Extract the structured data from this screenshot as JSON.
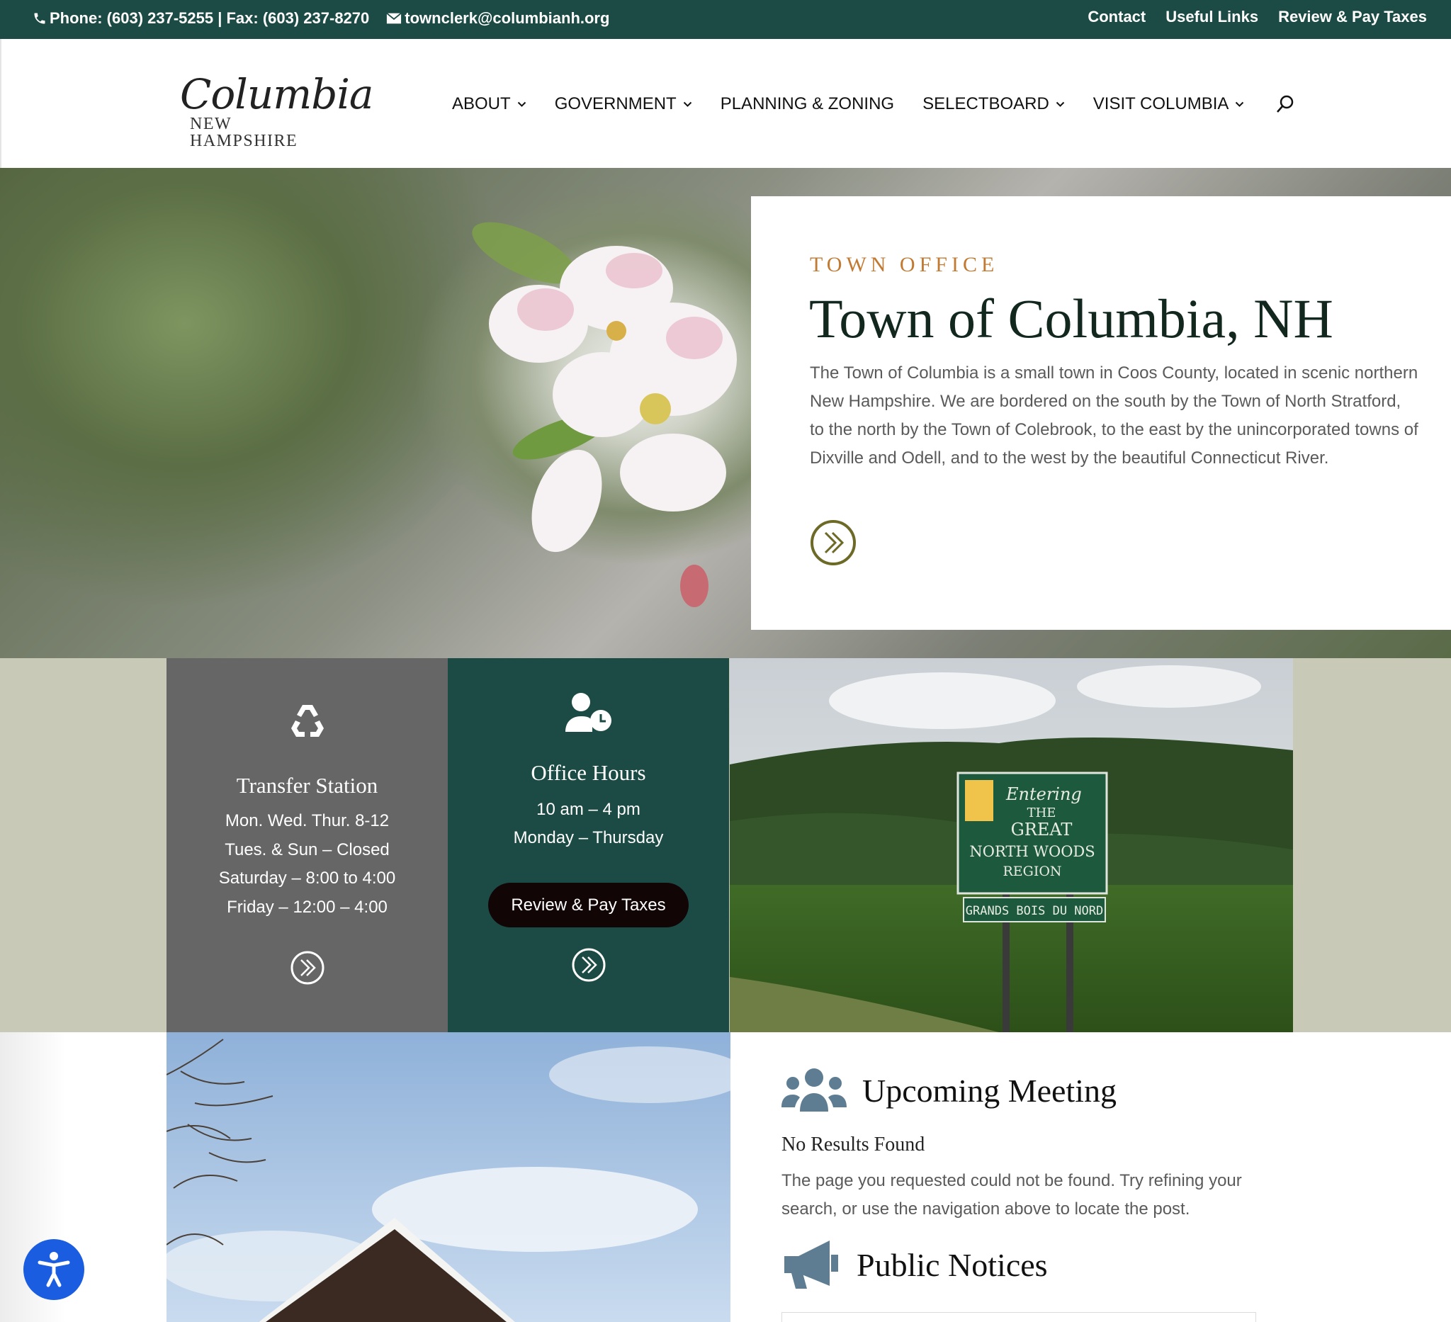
{
  "topbar": {
    "phone_fax": "Phone: (603) 237-5255 | Fax: (603) 237-8270",
    "email": "townclerk@columbianh.org",
    "links": [
      "Contact",
      "Useful Links",
      "Review & Pay Taxes"
    ]
  },
  "header": {
    "logo_script": "Columbia",
    "logo_sub": "NEW HAMPSHIRE",
    "nav": [
      "ABOUT",
      "GOVERNMENT",
      "PLANNING & ZONING",
      "SELECTBOARD",
      "VISIT COLUMBIA"
    ],
    "search_icon": "search-icon"
  },
  "hero": {
    "eyebrow": "TOWN OFFICE",
    "title": "Town of Columbia, NH",
    "description": "The Town of Columbia is a small town in Coos County, located in scenic northern New Hampshire. We are bordered on the south by the Town of North Stratford, to the north by the Town of Colebrook, to the east by the unincorporated towns of Dixville and Odell, and to the west by the beautiful Connecticut River.",
    "go_icon": "double-chevron-circle-icon"
  },
  "transfer": {
    "icon": "recycle-icon",
    "title": "Transfer Station",
    "lines": [
      "Mon. Wed. Thur. 8-12",
      "Tues. & Sun – Closed",
      "Saturday – 8:00 to 4:00",
      "Friday – 12:00 – 4:00"
    ]
  },
  "hours": {
    "icon": "user-clock-icon",
    "title": "Office Hours",
    "lines": [
      "10 am – 4 pm",
      "Monday – Thursday"
    ],
    "button": "Review & Pay Taxes"
  },
  "sign": {
    "line1": "Entering",
    "line2": "THE",
    "line3": "GREAT",
    "line4": "NORTH WOODS",
    "line5": "REGION",
    "line6": "GRANDS BOIS DU NORD"
  },
  "meeting": {
    "icon": "users-icon",
    "title": "Upcoming Meeting",
    "no_results": "No Results Found",
    "message": "The page you requested could not be found. Try refining your search, or use the navigation above to locate the post."
  },
  "notices": {
    "icon": "megaphone-icon",
    "title": "Public Notices"
  },
  "colors": {
    "topbar": "#1c4b45",
    "accent_orange": "#c27a33",
    "olive": "#6d6a27",
    "transfer_tile": "#666666",
    "hours_tile": "#1c4b45",
    "band": "#c9c9b7",
    "accessibility": "#1a5de0"
  }
}
